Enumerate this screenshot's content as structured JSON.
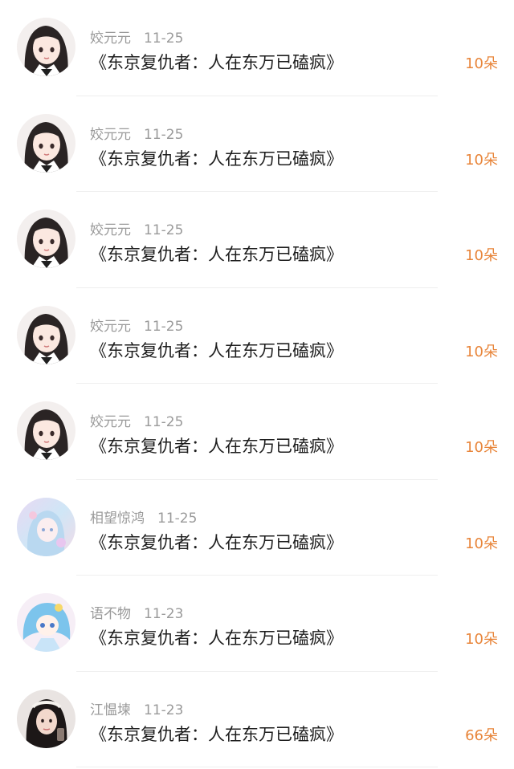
{
  "gifts": [
    {
      "avatar": "girl-dark-hair-avatar",
      "user": "姣元元",
      "date": "11-25",
      "title": "《东京复仇者：人在东万已磕疯》",
      "amount": "10朵"
    },
    {
      "avatar": "girl-dark-hair-avatar",
      "user": "姣元元",
      "date": "11-25",
      "title": "《东京复仇者：人在东万已磕疯》",
      "amount": "10朵"
    },
    {
      "avatar": "girl-dark-hair-avatar",
      "user": "姣元元",
      "date": "11-25",
      "title": "《东京复仇者：人在东万已磕疯》",
      "amount": "10朵"
    },
    {
      "avatar": "girl-dark-hair-avatar",
      "user": "姣元元",
      "date": "11-25",
      "title": "《东京复仇者：人在东万已磕疯》",
      "amount": "10朵"
    },
    {
      "avatar": "girl-dark-hair-avatar",
      "user": "姣元元",
      "date": "11-25",
      "title": "《东京复仇者：人在东万已磕疯》",
      "amount": "10朵"
    },
    {
      "avatar": "pastel-anime-avatar",
      "user": "相望惊鸿",
      "date": "11-25",
      "title": "《东京复仇者：人在东万已磕疯》",
      "amount": "10朵"
    },
    {
      "avatar": "blue-hair-anime-avatar",
      "user": "语不物",
      "date": "11-23",
      "title": "《东京复仇者：人在东万已磕疯》",
      "amount": "10朵"
    },
    {
      "avatar": "photo-girl-avatar",
      "user": "江愠堜",
      "date": "11-23",
      "title": "《东京复仇者：人在东万已磕疯》",
      "amount": "66朵"
    }
  ],
  "colors": {
    "amount": "#e8853a",
    "meta": "#9a9a9a",
    "title": "#1e1e1e"
  }
}
